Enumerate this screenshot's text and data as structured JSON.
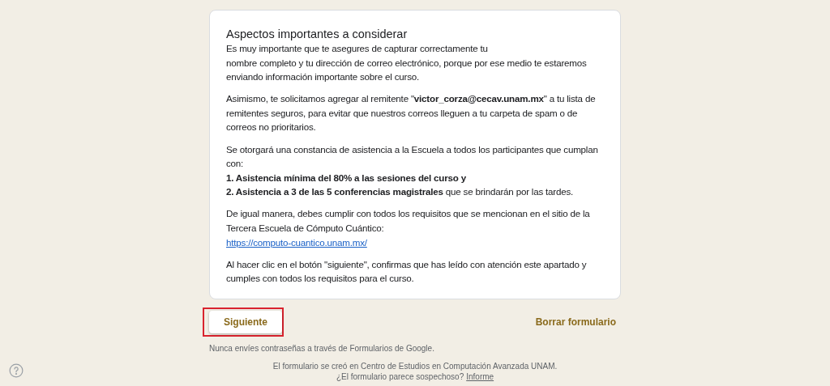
{
  "card": {
    "title": "Aspectos importantes a considerar",
    "paragraphs": [
      {
        "lines": [
          {
            "kind": "text",
            "text": "Es muy importante que te asegures de capturar correctamente tu"
          },
          {
            "kind": "text",
            "text": "nombre completo y tu dirección de correo electrónico, porque por ese medio te estaremos enviando información importante sobre el curso."
          }
        ]
      },
      {
        "lines": [
          {
            "kind": "text",
            "text": "Asimismo, te solicitamos agregar al remitente \"**victor_corza@cecav.unam.mx**\" a tu lista de remitentes seguros, para evitar que nuestros correos lleguen a tu carpeta de spam o de correos no prioritarios."
          }
        ]
      },
      {
        "lines": [
          {
            "kind": "text",
            "text": "Se otorgará una constancia de asistencia a la Escuela a todos los participantes que cumplan con:"
          },
          {
            "kind": "text",
            "text": "**1. Asistencia mínima del 80% a las sesiones del curso y**"
          },
          {
            "kind": "text",
            "text": "**2. Asistencia a 3 de las 5 conferencias magistrales** que se brindarán por las tardes."
          }
        ]
      },
      {
        "lines": [
          {
            "kind": "text",
            "text": "De igual manera, debes cumplir con todos los requisitos que se mencionan en el sitio de la Tercera Escuela de Cómputo Cuántico:"
          },
          {
            "kind": "link",
            "text": "https://computo-cuantico.unam.mx/"
          }
        ]
      },
      {
        "lines": [
          {
            "kind": "text",
            "text": "Al hacer clic en el botón \"siguiente\", confirmas que has leído con atención este apartado y cumples con todos los requisitos para el curso."
          }
        ]
      }
    ]
  },
  "next_button": {
    "label": "Siguiente",
    "highlighted": true
  },
  "clear_button": {
    "label": "Borrar formulario"
  },
  "warning": "Nunca envíes contraseñas a través de Formularios de Google.",
  "footer": {
    "line": "El formulario se creó en Centro de Estudios en Computación Avanzada UNAM.",
    "question": "¿El formulario parece sospechoso?",
    "report_link": "Informe"
  }
}
